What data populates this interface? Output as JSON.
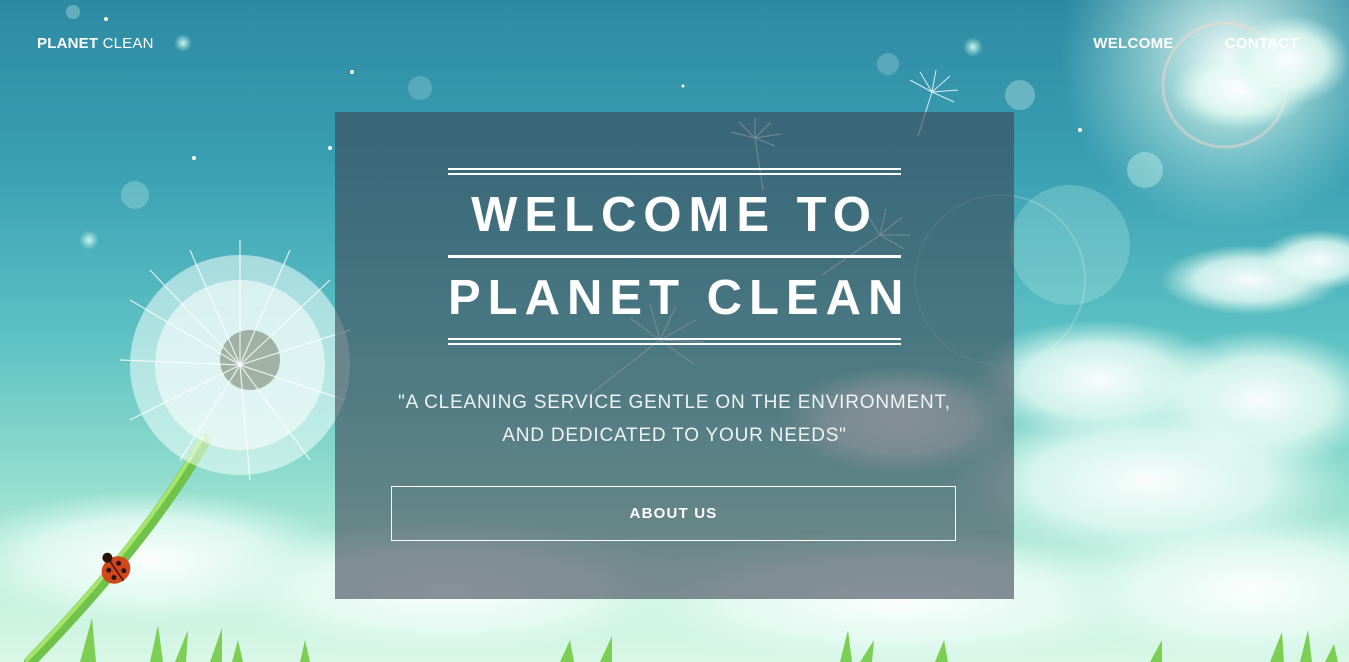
{
  "navbar": {
    "brand_bold": "PLANET",
    "brand_light": "CLEAN",
    "links": [
      {
        "label": "WELCOME"
      },
      {
        "label": "CONTACT"
      }
    ]
  },
  "hero": {
    "title_line_1": "WELCOME TO",
    "title_line_2": "PLANET CLEAN",
    "tagline_line_1": "\"A CLEANING SERVICE GENTLE ON THE ENVIRONMENT,",
    "tagline_line_2": "AND DEDICATED TO YOUR NEEDS\"",
    "button_label": "ABOUT US"
  },
  "colors": {
    "sky_top": "#2e8aa3",
    "sky_bottom": "#d9f7e6",
    "panel_overlay": "rgba(60,70,85,0.6)",
    "text": "#ffffff"
  },
  "icons": [
    "dandelion-illustration",
    "ladybug-icon",
    "sun-flare",
    "cloud-shape",
    "grass-blades"
  ]
}
